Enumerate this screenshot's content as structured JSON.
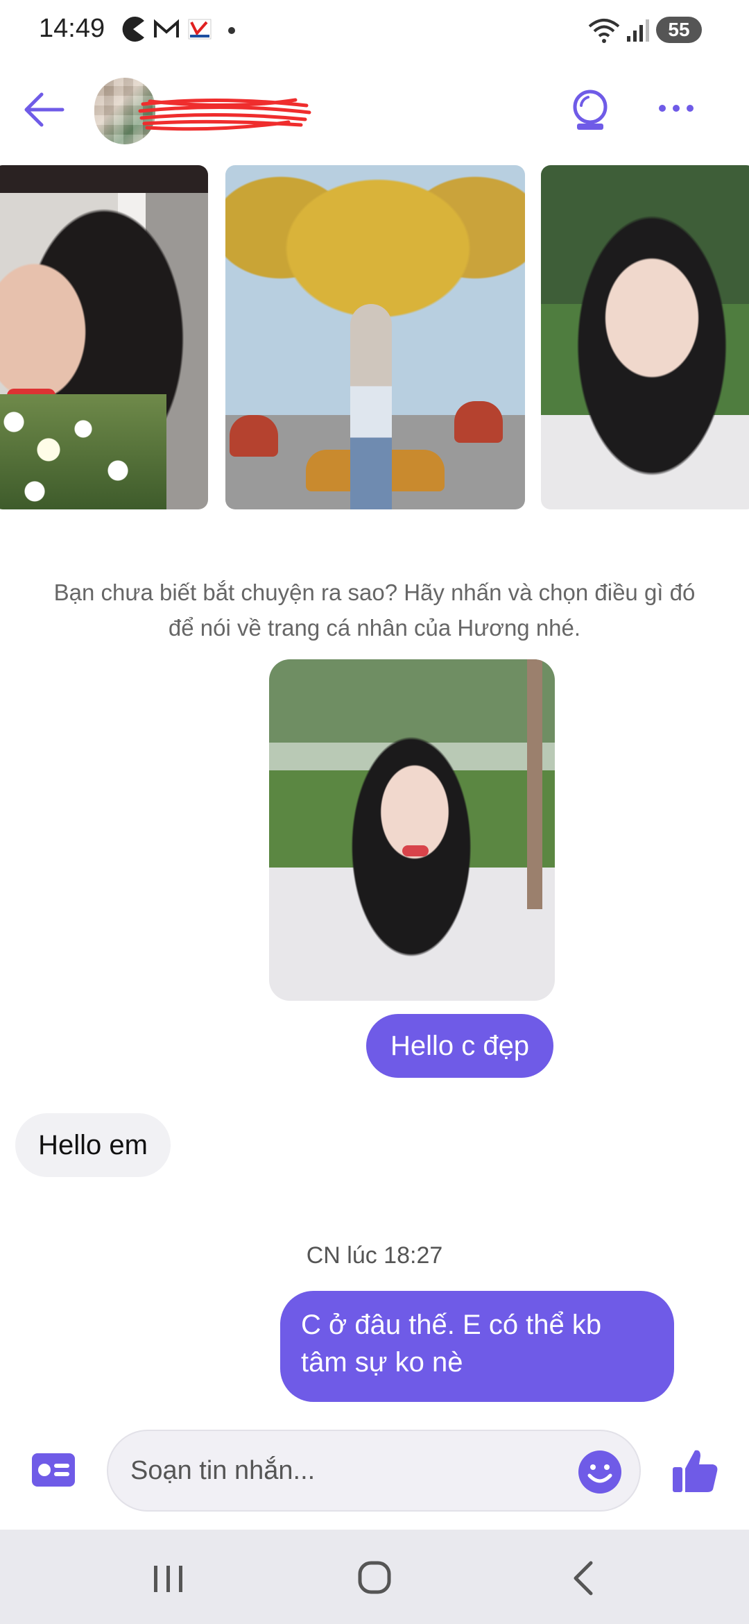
{
  "status_bar": {
    "time": "14:49",
    "icons": [
      "pacman-icon",
      "gmail-icon",
      "vnpay-icon",
      "dot-icon",
      "wifi-icon",
      "signal-icon"
    ],
    "battery": "55"
  },
  "header": {
    "back_icon": "arrow-left-icon",
    "contact_name_redacted": true,
    "actions": [
      "crystal-ball-icon",
      "more-icon"
    ]
  },
  "photos": [
    "photo-1",
    "photo-2",
    "photo-3"
  ],
  "conversation": {
    "prompt": "Bạn chưa biết bắt chuyện ra sao? Hãy nhấn và chọn điều gì đó để nói về trang cá nhân của Hương nhé.",
    "messages": [
      {
        "direction": "out",
        "text": "Hello c đẹp"
      },
      {
        "direction": "in",
        "text": "Hello em"
      }
    ],
    "timestamp": "CN lúc 18:27",
    "last_message": {
      "direction": "out",
      "text": "C ở đâu thế. E có thể kb tâm sự ko nè"
    }
  },
  "composer": {
    "placeholder": "Soạn tin nhắn..."
  },
  "colors": {
    "accent": "#6f5be7",
    "incoming_bubble": "#f1f1f4"
  }
}
